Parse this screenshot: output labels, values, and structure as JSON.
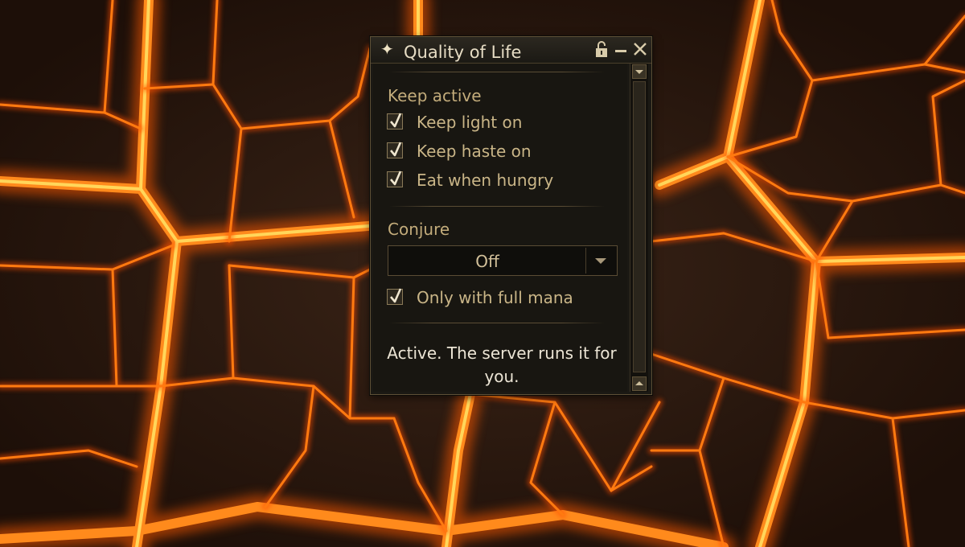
{
  "window": {
    "title": "Quality of Life",
    "icons": {
      "title": "sparkle-icon",
      "lock": "unlocked-padlock-icon",
      "minimize": "minimize-icon",
      "close": "close-icon"
    }
  },
  "keep_active": {
    "heading": "Keep active",
    "options": [
      {
        "label": "Keep light on",
        "checked": true
      },
      {
        "label": "Keep haste on",
        "checked": true
      },
      {
        "label": "Eat when hungry",
        "checked": true
      }
    ]
  },
  "conjure": {
    "heading": "Conjure",
    "selected": "Off",
    "full_mana_option": {
      "label": "Only with full mana",
      "checked": true
    }
  },
  "status": {
    "message": "Active. The server runs it for you."
  },
  "colors": {
    "panel_bg": "#1b1914",
    "gold_text": "#c3ac7b",
    "lava_glow": "#ff8a1c"
  }
}
